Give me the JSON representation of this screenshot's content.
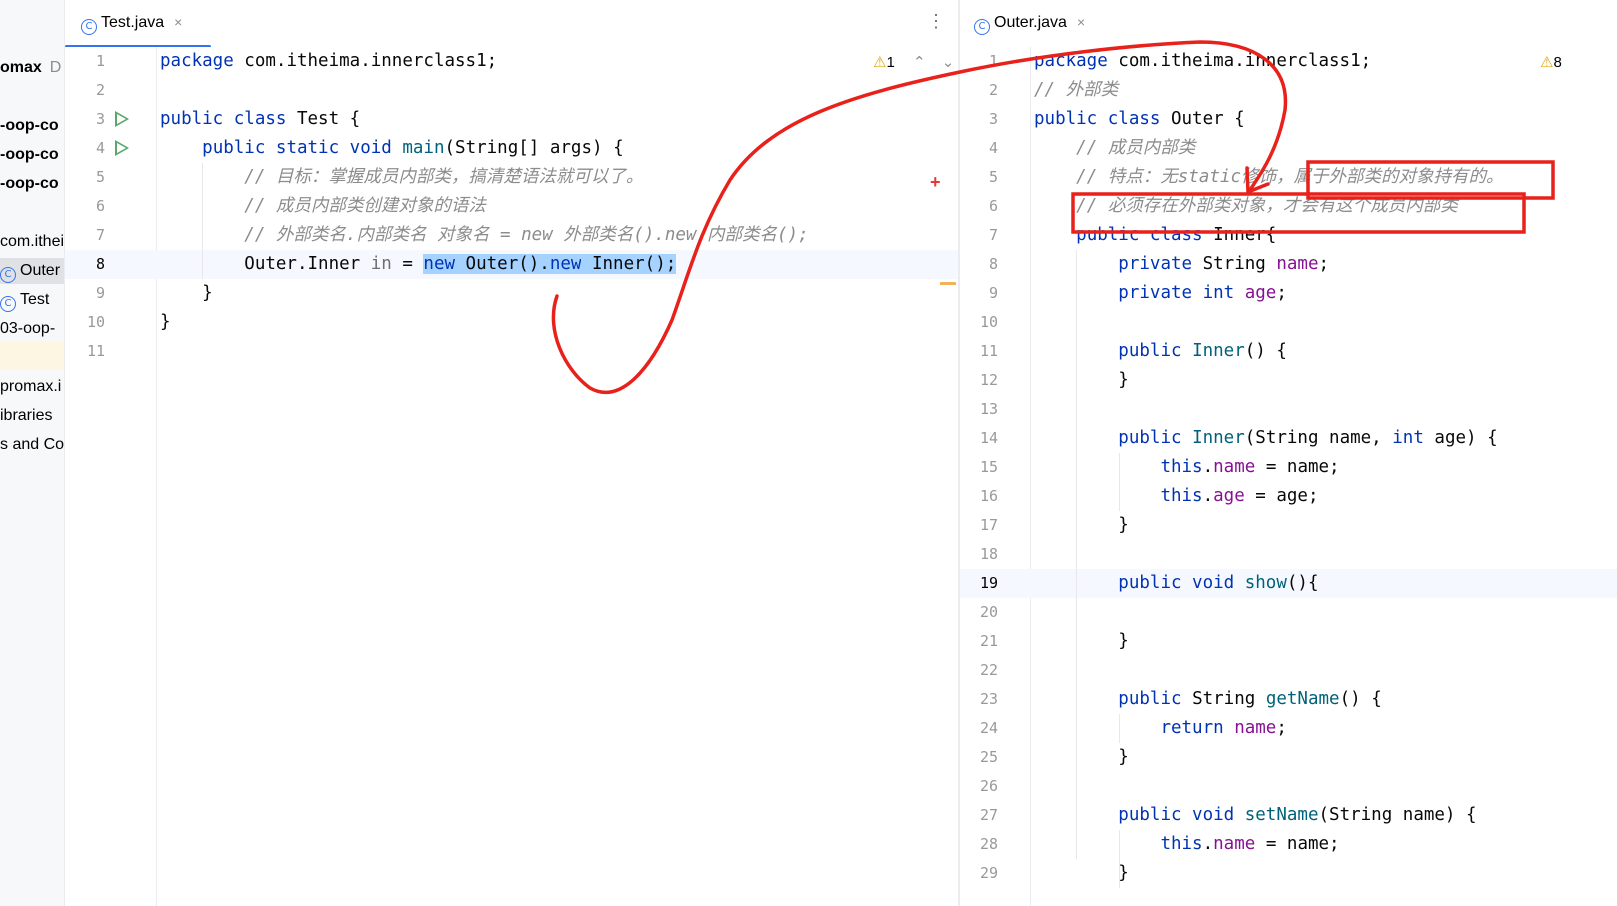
{
  "sidebar": {
    "items": [
      {
        "label": "omax",
        "suffix": "D",
        "style": "bold"
      },
      {
        "label": "-oop-co",
        "style": "bold"
      },
      {
        "label": "-oop-co",
        "style": "bold"
      },
      {
        "label": "-oop-co",
        "style": "bold"
      },
      {
        "label": "com.ithei",
        "style": "normal"
      },
      {
        "label": "Outer",
        "style": "class-selected"
      },
      {
        "label": "Test",
        "style": "class"
      },
      {
        "label": "03-oop-",
        "style": "normal"
      },
      {
        "label": "promax.i",
        "style": "normal"
      },
      {
        "label": "ibraries",
        "style": "normal"
      },
      {
        "label": "s and Co",
        "style": "normal"
      }
    ]
  },
  "left_pane": {
    "tab_label": "Test.java",
    "tab_close": "×",
    "menu_glyph": "⋮",
    "warning_count": "1",
    "cursor_line": 8,
    "lines": [
      {
        "n": "1",
        "tokens": [
          [
            "kw",
            "package "
          ],
          [
            "",
            "com.itheima.innerclass1;"
          ]
        ]
      },
      {
        "n": "2",
        "tokens": []
      },
      {
        "n": "3",
        "run": true,
        "tokens": [
          [
            "kw",
            "public class "
          ],
          [
            "",
            "Test {"
          ]
        ]
      },
      {
        "n": "4",
        "run": true,
        "tokens": [
          [
            "",
            "    "
          ],
          [
            "kw",
            "public static void "
          ],
          [
            "mth",
            "main"
          ],
          [
            "",
            "(String[] args) {"
          ]
        ]
      },
      {
        "n": "5",
        "tokens": [
          [
            "",
            "        "
          ],
          [
            "cm",
            "// 目标：掌握成员内部类，搞清楚语法就可以了。"
          ]
        ]
      },
      {
        "n": "6",
        "tokens": [
          [
            "",
            "        "
          ],
          [
            "cm",
            "// 成员内部类创建对象的语法"
          ]
        ]
      },
      {
        "n": "7",
        "tokens": [
          [
            "",
            "        "
          ],
          [
            "cm",
            "// 外部类名.内部类名 对象名 = new 外部类名().new 内部类名();"
          ]
        ]
      },
      {
        "n": "8",
        "tokens": [
          [
            "",
            "        Outer.Inner "
          ],
          [
            "dim",
            "in"
          ],
          [
            "",
            " = "
          ],
          [
            "sel-kw",
            "new"
          ],
          [
            "sel",
            " Outer()."
          ],
          [
            "sel-kw",
            "new"
          ],
          [
            "sel",
            " Inner();"
          ]
        ]
      },
      {
        "n": "9",
        "tokens": [
          [
            "",
            "    }"
          ]
        ]
      },
      {
        "n": "10",
        "tokens": [
          [
            "",
            "}"
          ]
        ]
      },
      {
        "n": "11",
        "tokens": []
      }
    ]
  },
  "right_pane": {
    "tab_label": "Outer.java",
    "tab_close": "×",
    "warning_count": "8",
    "cursor_line": 19,
    "lines": [
      {
        "n": "1",
        "tokens": [
          [
            "kw",
            "package "
          ],
          [
            "",
            "com.itheima.innerclass1;"
          ]
        ]
      },
      {
        "n": "2",
        "tokens": [
          [
            "cm",
            "// 外部类"
          ]
        ]
      },
      {
        "n": "3",
        "tokens": [
          [
            "kw",
            "public class "
          ],
          [
            "",
            "Outer {"
          ]
        ]
      },
      {
        "n": "4",
        "tokens": [
          [
            "",
            "    "
          ],
          [
            "cm",
            "// 成员内部类"
          ]
        ]
      },
      {
        "n": "5",
        "tokens": [
          [
            "",
            "    "
          ],
          [
            "cm",
            "// 特点：无static修饰，属于外部类的对象持有的。"
          ]
        ]
      },
      {
        "n": "6",
        "tokens": [
          [
            "",
            "    "
          ],
          [
            "cm",
            "// 必须存在外部类对象，才会有这个成员内部类"
          ]
        ]
      },
      {
        "n": "7",
        "tokens": [
          [
            "",
            "    "
          ],
          [
            "kw",
            "public class "
          ],
          [
            "",
            "Inner{"
          ]
        ]
      },
      {
        "n": "8",
        "tokens": [
          [
            "",
            "        "
          ],
          [
            "kw",
            "private "
          ],
          [
            "",
            "String "
          ],
          [
            "fld",
            "name"
          ],
          [
            "",
            ";"
          ]
        ]
      },
      {
        "n": "9",
        "tokens": [
          [
            "",
            "        "
          ],
          [
            "kw",
            "private int "
          ],
          [
            "fld",
            "age"
          ],
          [
            "",
            ";"
          ]
        ]
      },
      {
        "n": "10",
        "tokens": []
      },
      {
        "n": "11",
        "tokens": [
          [
            "",
            "        "
          ],
          [
            "kw",
            "public "
          ],
          [
            "mth",
            "Inner"
          ],
          [
            "",
            "() {"
          ]
        ]
      },
      {
        "n": "12",
        "tokens": [
          [
            "",
            "        }"
          ]
        ]
      },
      {
        "n": "13",
        "tokens": []
      },
      {
        "n": "14",
        "tokens": [
          [
            "",
            "        "
          ],
          [
            "kw",
            "public "
          ],
          [
            "mth",
            "Inner"
          ],
          [
            "",
            "(String name, "
          ],
          [
            "kw",
            "int "
          ],
          [
            "",
            "age) {"
          ]
        ]
      },
      {
        "n": "15",
        "tokens": [
          [
            "",
            "            "
          ],
          [
            "kw",
            "this"
          ],
          [
            "",
            "."
          ],
          [
            "fld",
            "name"
          ],
          [
            "",
            " = name;"
          ]
        ]
      },
      {
        "n": "16",
        "tokens": [
          [
            "",
            "            "
          ],
          [
            "kw",
            "this"
          ],
          [
            "",
            "."
          ],
          [
            "fld",
            "age"
          ],
          [
            "",
            " = age;"
          ]
        ]
      },
      {
        "n": "17",
        "tokens": [
          [
            "",
            "        }"
          ]
        ]
      },
      {
        "n": "18",
        "tokens": []
      },
      {
        "n": "19",
        "tokens": [
          [
            "",
            "        "
          ],
          [
            "kw",
            "public void "
          ],
          [
            "mth",
            "show"
          ],
          [
            "",
            "(){"
          ]
        ]
      },
      {
        "n": "20",
        "tokens": []
      },
      {
        "n": "21",
        "tokens": [
          [
            "",
            "        }"
          ]
        ]
      },
      {
        "n": "22",
        "tokens": []
      },
      {
        "n": "23",
        "tokens": [
          [
            "",
            "        "
          ],
          [
            "kw",
            "public "
          ],
          [
            "",
            "String "
          ],
          [
            "mth",
            "getName"
          ],
          [
            "",
            "() {"
          ]
        ]
      },
      {
        "n": "24",
        "tokens": [
          [
            "",
            "            "
          ],
          [
            "kw",
            "return "
          ],
          [
            "fld",
            "name"
          ],
          [
            "",
            ";"
          ]
        ]
      },
      {
        "n": "25",
        "tokens": [
          [
            "",
            "        }"
          ]
        ]
      },
      {
        "n": "26",
        "tokens": []
      },
      {
        "n": "27",
        "tokens": [
          [
            "",
            "        "
          ],
          [
            "kw",
            "public void "
          ],
          [
            "mth",
            "setName"
          ],
          [
            "",
            "(String name) {"
          ]
        ]
      },
      {
        "n": "28",
        "tokens": [
          [
            "",
            "            "
          ],
          [
            "kw",
            "this"
          ],
          [
            "",
            "."
          ],
          [
            "fld",
            "name"
          ],
          [
            "",
            " = name;"
          ]
        ]
      },
      {
        "n": "29",
        "tokens": [
          [
            "",
            "        }"
          ]
        ]
      }
    ]
  },
  "colors": {
    "keyword": "#0033b3",
    "comment": "#8c8c8c",
    "field": "#871094",
    "method": "#00627a",
    "selection": "#a6d2ff",
    "annotation": "#e8211b",
    "run": "#59a869"
  }
}
